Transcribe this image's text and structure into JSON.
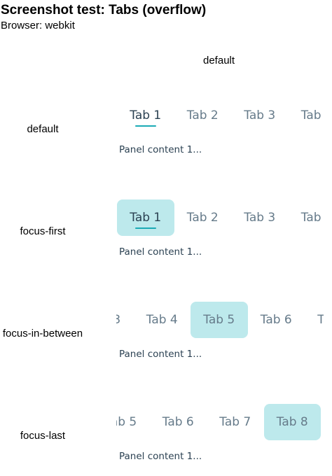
{
  "page": {
    "title": "Screenshot test: Tabs (overflow)",
    "browser_label": "Browser: webkit",
    "column_header": "default"
  },
  "tab_labels": [
    "Tab 1",
    "Tab 2",
    "Tab 3",
    "Tab 4",
    "Tab 5",
    "Tab 6",
    "Tab 7",
    "Tab 8"
  ],
  "panel_text": "Panel content 1...",
  "rows": [
    {
      "label": "default",
      "selected_tab": "Tab 1",
      "focused_tab": null
    },
    {
      "label": "focus-first",
      "selected_tab": "Tab 1",
      "focused_tab": "Tab 1"
    },
    {
      "label": "focus-in-between",
      "selected_tab": "Tab 1",
      "focused_tab": "Tab 5"
    },
    {
      "label": "focus-last",
      "selected_tab": "Tab 1",
      "focused_tab": "Tab 8"
    }
  ],
  "colors": {
    "tab_text": "#667b8a",
    "tab_selected_text": "#2b4152",
    "focus_background": "#bde9ec",
    "underline": "#1aaab5",
    "panel_text": "#2b4152"
  }
}
